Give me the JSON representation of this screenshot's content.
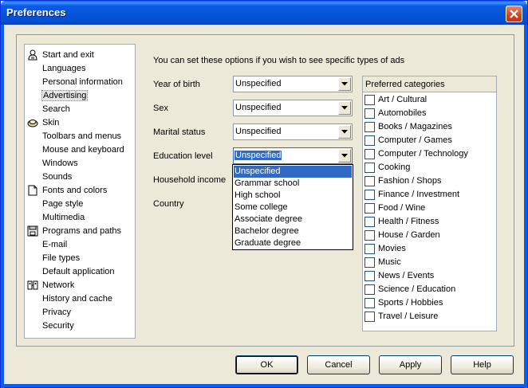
{
  "window": {
    "title": "Preferences"
  },
  "tree": {
    "items": [
      {
        "label": "Start and exit",
        "icon": "person-icon"
      },
      {
        "label": "Languages",
        "icon": ""
      },
      {
        "label": "Personal information",
        "icon": ""
      },
      {
        "label": "Advertising",
        "icon": "",
        "selected": true
      },
      {
        "label": "Search",
        "icon": ""
      },
      {
        "label": "Skin",
        "icon": "skin-icon"
      },
      {
        "label": "Toolbars and menus",
        "icon": ""
      },
      {
        "label": "Mouse and keyboard",
        "icon": ""
      },
      {
        "label": "Windows",
        "icon": ""
      },
      {
        "label": "Sounds",
        "icon": ""
      },
      {
        "label": "Fonts and colors",
        "icon": "document-icon"
      },
      {
        "label": "Page style",
        "icon": ""
      },
      {
        "label": "Multimedia",
        "icon": ""
      },
      {
        "label": "Programs and paths",
        "icon": "floppy-icon"
      },
      {
        "label": "E-mail",
        "icon": ""
      },
      {
        "label": "File types",
        "icon": ""
      },
      {
        "label": "Default application",
        "icon": ""
      },
      {
        "label": "Network",
        "icon": "network-icon"
      },
      {
        "label": "History and cache",
        "icon": ""
      },
      {
        "label": "Privacy",
        "icon": ""
      },
      {
        "label": "Security",
        "icon": ""
      }
    ]
  },
  "advertising": {
    "intro": "You can set these options if you wish to see specific types of ads",
    "fields": [
      {
        "label": "Year of birth",
        "value": "Unspecified"
      },
      {
        "label": "Sex",
        "value": "Unspecified"
      },
      {
        "label": "Marital status",
        "value": "Unspecified"
      },
      {
        "label": "Education level",
        "value": "Unspecified"
      },
      {
        "label": "Household income",
        "value": ""
      },
      {
        "label": "Country",
        "value": ""
      }
    ],
    "education_options": [
      "Unspecified",
      "Grammar school",
      "High school",
      "Some college",
      "Associate degree",
      "Bachelor degree",
      "Graduate degree"
    ],
    "categories_header": "Preferred categories",
    "categories": [
      "Art / Cultural",
      "Automobiles",
      "Books / Magazines",
      "Computer / Games",
      "Computer / Technology",
      "Cooking",
      "Fashion / Shops",
      "Finance / Investment",
      "Food / Wine",
      "Health / Fitness",
      "House / Garden",
      "Movies",
      "Music",
      "News / Events",
      "Science / Education",
      "Sports / Hobbies",
      "Travel / Leisure"
    ]
  },
  "buttons": {
    "ok": "OK",
    "cancel": "Cancel",
    "apply": "Apply",
    "help": "Help"
  },
  "colors": {
    "title_bar": "#0a5eea",
    "selection": "#316ac5",
    "close_button": "#d5431c"
  }
}
